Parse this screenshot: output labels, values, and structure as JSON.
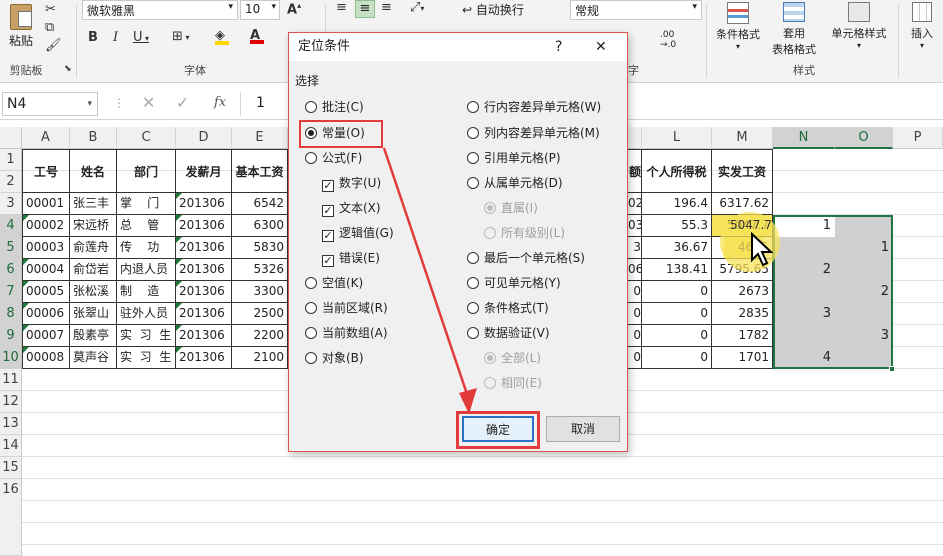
{
  "ribbon": {
    "paste_label": "粘贴",
    "clipboard_label": "剪贴板",
    "font_name": "微软雅黑",
    "font_size": "10",
    "font_group_label": "字体",
    "bold": "B",
    "italic": "I",
    "underline": "U",
    "wrap_text_label": "自动换行",
    "number_format": "常规",
    "number_group_partial": "字",
    "conditional_format_label": "条件格式",
    "apply_table_label_1": "套用",
    "apply_table_label_2": "表格格式",
    "cell_style_label": "单元格样式",
    "styles_group_label": "样式",
    "insert_label": "插入"
  },
  "formula_bar": {
    "name_box": "N4",
    "fx": "fx",
    "value": "1"
  },
  "columns": [
    "A",
    "B",
    "C",
    "D",
    "E",
    "L",
    "M",
    "N",
    "O",
    "P"
  ],
  "rows": [
    "1",
    "2",
    "3",
    "4",
    "5",
    "6",
    "7",
    "8",
    "9",
    "10",
    "11",
    "12",
    "13",
    "14",
    "15",
    "16"
  ],
  "headers": {
    "a": "工号",
    "b": "姓名",
    "c": "部门",
    "d": "发薪月",
    "e": "基本工资",
    "k_partial": "额",
    "l": "个人所得税",
    "m": "实发工资"
  },
  "table_rows": [
    {
      "a": "00001",
      "b": "张三丰",
      "c": "掌    门",
      "d": "201306",
      "e": "6542",
      "k": "02",
      "l": "196.4",
      "m": "6317.62"
    },
    {
      "a": "00002",
      "b": "宋远桥",
      "c": "总    管",
      "d": "201306",
      "e": "6300",
      "k": "03",
      "l": "55.3",
      "m": "5047.7"
    },
    {
      "a": "00003",
      "b": "俞莲舟",
      "c": "传    功",
      "d": "201306",
      "e": "5830",
      "k": "3",
      "l": "36.67",
      "m": "4685"
    },
    {
      "a": "00004",
      "b": "俞岱岩",
      "c": "内退人员",
      "d": "201306",
      "e": "5326",
      "k": "06",
      "l": "138.41",
      "m": "5795.65"
    },
    {
      "a": "00005",
      "b": "张松溪",
      "c": "制    造",
      "d": "201306",
      "e": "3300",
      "k": "0",
      "l": "0",
      "m": "2673"
    },
    {
      "a": "00006",
      "b": "张翠山",
      "c": "驻外人员",
      "d": "201306",
      "e": "2500",
      "k": "0",
      "l": "0",
      "m": "2835"
    },
    {
      "a": "00007",
      "b": "殷素亭",
      "c": "实  习  生",
      "d": "201306",
      "e": "2200",
      "k": "0",
      "l": "0",
      "m": "1782"
    },
    {
      "a": "00008",
      "b": "莫声谷",
      "c": "实  习  生",
      "d": "201306",
      "e": "2100",
      "k": "0",
      "l": "0",
      "m": "1701"
    }
  ],
  "n_values": [
    "1",
    "",
    "2",
    "",
    "3",
    "",
    "4",
    ""
  ],
  "o_values": [
    "",
    "1",
    "",
    "2",
    "",
    "3",
    "",
    ""
  ],
  "dialog": {
    "title": "定位条件",
    "help": "?",
    "close": "✕",
    "section": "选择",
    "left_options": [
      "批注(C)",
      "常量(O)",
      "公式(F)",
      "数字(U)",
      "文本(X)",
      "逻辑值(G)",
      "错误(E)",
      "空值(K)",
      "当前区域(R)",
      "当前数组(A)",
      "对象(B)"
    ],
    "right_options": [
      "行内容差异单元格(W)",
      "列内容差异单元格(M)",
      "引用单元格(P)",
      "从属单元格(D)",
      "直属(I)",
      "所有级别(L)",
      "最后一个单元格(S)",
      "可见单元格(Y)",
      "条件格式(T)",
      "数据验证(V)",
      "全部(L)",
      "相同(E)"
    ],
    "ok": "确定",
    "cancel": "取消"
  },
  "colors": {
    "accent_green": "#217346",
    "highlight_red": "#e23b3b",
    "cursor_yellow": "#f7e35a"
  }
}
